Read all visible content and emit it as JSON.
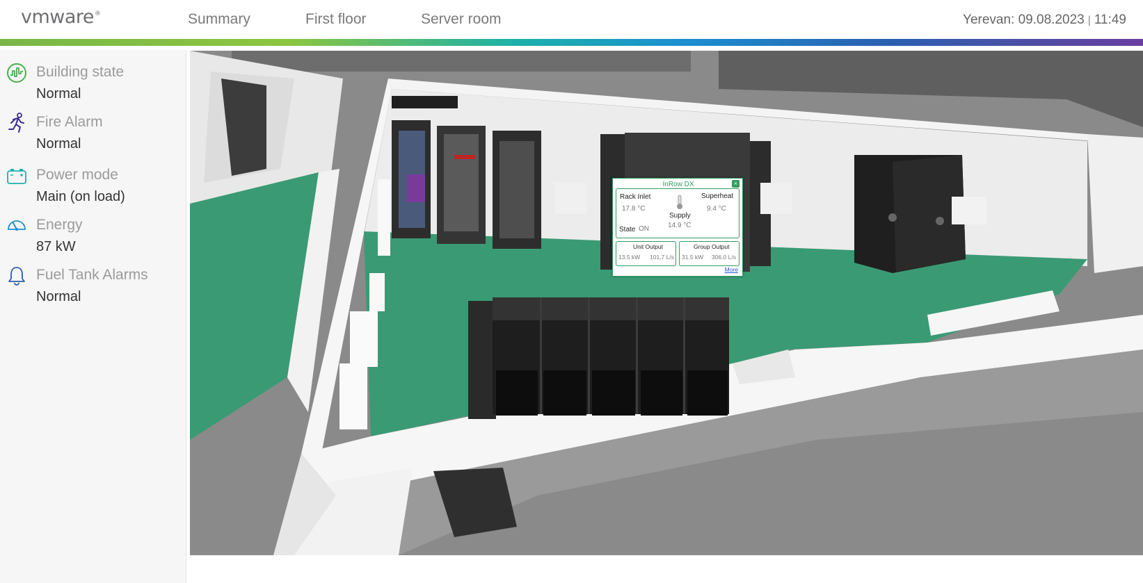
{
  "header": {
    "logo_text": "vmware",
    "nav": [
      "Summary",
      "First floor",
      "Server room"
    ],
    "location": "Yerevan:",
    "date": "09.08.2023",
    "separator": "|",
    "time": "11:49"
  },
  "colors": {
    "accent_green": "#7ab648",
    "accent_teal": "#1db1a9",
    "accent_blue": "#1c8fd0",
    "accent_purple": "#6a3fa0",
    "floor_green": "#3a9a74",
    "popup_green": "#2f9e5e"
  },
  "sidebar": {
    "items": [
      {
        "icon": "building-chart-icon",
        "label": "Building state",
        "value": "Normal",
        "color": "#4caf50"
      },
      {
        "icon": "running-person-icon",
        "label": "Fire Alarm",
        "value": "Normal",
        "color": "#3b2b8f"
      },
      {
        "icon": "battery-icon",
        "label": "Power mode",
        "value": "Main (on load)",
        "color": "#1db1a9"
      },
      {
        "icon": "speedometer-icon",
        "label": "Energy",
        "value": "87 kW",
        "color": "#1c8fd0"
      },
      {
        "icon": "bell-icon",
        "label": "Fuel Tank Alarms",
        "value": "Normal",
        "color": "#2a5fae"
      }
    ]
  },
  "popup": {
    "title": "InRow DX",
    "rack_inlet_label": "Rack Inlet",
    "rack_inlet_value": "17.8 °C",
    "supply_label": "Supply",
    "supply_value": "14.9 °C",
    "superheat_label": "Superheat",
    "superheat_value": "9.4 °C",
    "state_label": "State",
    "state_value": "ON",
    "unit_output_label": "Unit Output",
    "unit_output_kw": "13.5 kW",
    "unit_output_flow": "101.7 L/s",
    "group_output_label": "Group Output",
    "group_output_kw": "31.5 kW",
    "group_output_flow": "306.0 L/s",
    "more_label": "More"
  }
}
